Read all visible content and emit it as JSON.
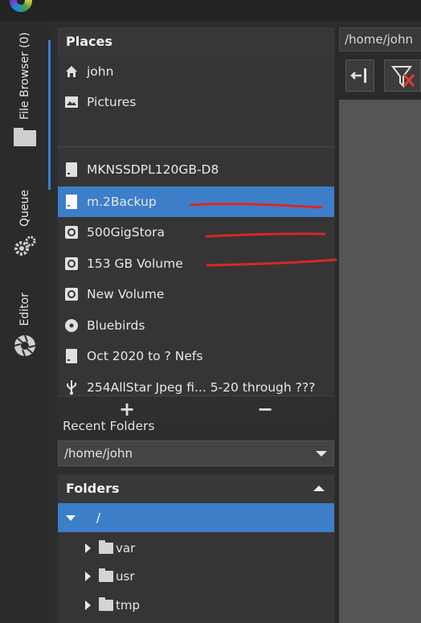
{
  "window": {
    "logo": "rawtherapee-logo"
  },
  "side_tabs": [
    {
      "label": "File Browser (0)",
      "icon": "folder-icon"
    },
    {
      "label": "Queue",
      "icon": "gears-icon"
    },
    {
      "label": "Editor",
      "icon": "aperture-icon"
    }
  ],
  "places": {
    "title": "Places",
    "items": [
      {
        "label": "john",
        "icon": "home-icon"
      },
      {
        "label": "Pictures",
        "icon": "image-icon"
      },
      {
        "label": "MKNSSDPL120GB-D8",
        "icon": "drive-icon"
      },
      {
        "label": "m.2Backup",
        "icon": "drive-icon",
        "selected": true
      },
      {
        "label": "500GigStora",
        "icon": "hard-disk-icon"
      },
      {
        "label": "153 GB Volume",
        "icon": "hard-disk-icon"
      },
      {
        "label": "New Volume",
        "icon": "hard-disk-icon"
      },
      {
        "label": "Bluebirds",
        "icon": "optical-disc-icon"
      },
      {
        "label": "Oct 2020 to ? Nefs",
        "icon": "drive-icon"
      },
      {
        "label": "254AllStar Jpeg fi... 5-20 through ???",
        "icon": "usb-icon"
      }
    ],
    "add_label": "+",
    "remove_label": "−"
  },
  "recent_folders": {
    "label": "Recent Folders",
    "value": "/home/john"
  },
  "folders": {
    "title": "Folders",
    "tree": [
      {
        "label": "/",
        "expanded": true,
        "selected": true
      },
      {
        "label": "var",
        "expanded": false
      },
      {
        "label": "usr",
        "expanded": false
      },
      {
        "label": "tmp",
        "expanded": false
      }
    ]
  },
  "right": {
    "path": "/home/john"
  },
  "colors": {
    "selection": "#3d7ec9",
    "accent": "#3b7fd0",
    "annotation": "#d62828"
  }
}
